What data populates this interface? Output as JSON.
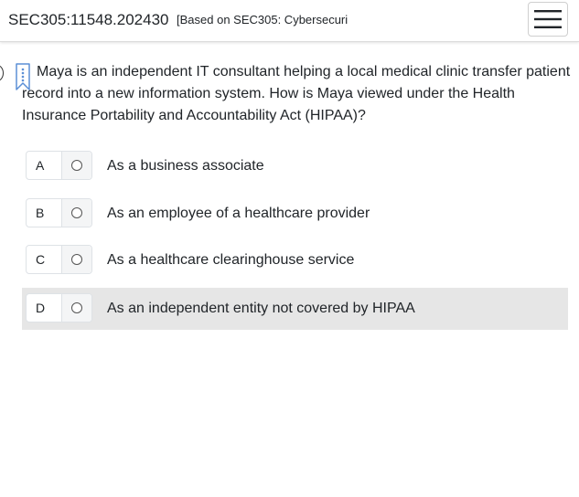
{
  "header": {
    "course_code": "SEC305:11548.202430",
    "course_subtitle": "[Based on SEC305: Cybersecuri",
    "menu_icon": "hamburger-menu-icon"
  },
  "question": {
    "bookmark_icon": "bookmark-icon",
    "text": "Maya is an independent IT consultant helping a local medical clinic transfer patient record into a new information system. How is Maya viewed under the Health Insurance Portability and Accountability Act (HIPAA)?"
  },
  "options": [
    {
      "letter": "A",
      "text": "As a business associate",
      "selected": false
    },
    {
      "letter": "B",
      "text": "As an employee of a healthcare provider",
      "selected": false
    },
    {
      "letter": "C",
      "text": "As a healthcare clearinghouse service",
      "selected": false
    },
    {
      "letter": "D",
      "text": "As an independent entity not covered by HIPAA",
      "selected": false
    }
  ],
  "colors": {
    "highlight_row": "#e6e6e6",
    "bookmark": "#5b8fd6",
    "text": "#212529"
  }
}
